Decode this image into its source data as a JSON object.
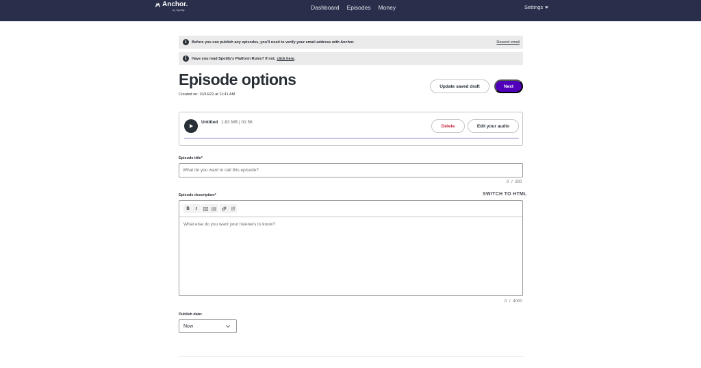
{
  "topbar": {
    "logo_text": "Anchor.",
    "logo_sub": "by Spotify",
    "nav": [
      "Dashboard",
      "Episodes",
      "Money"
    ],
    "settings_label": "Settings"
  },
  "banners": {
    "verify_text": "Before you can publish any episodes, you'll need to verify your email address with Anchor.",
    "resend_label": "Resend email",
    "rules_text": "Have you read Spotify's Platform Rules? If not,",
    "rules_link": "click here",
    "rules_suffix": "."
  },
  "page": {
    "title": "Episode options",
    "created": "Created on: 10/16/22 at 11:41 AM",
    "update_draft_label": "Update saved draft",
    "next_label": "Next"
  },
  "audio": {
    "name": "Untitled",
    "meta": "1.82 MB | 01:56",
    "delete_label": "Delete",
    "edit_label": "Edit your audio",
    "progress": 0
  },
  "form": {
    "title_label": "Episode title*",
    "title_placeholder": "What do you want to call this episode?",
    "title_counter": "0 / 200",
    "desc_label": "Episode description*",
    "switch_html_label": "SWITCH TO HTML",
    "desc_placeholder": "What else do you want your listeners to know?",
    "desc_counter": "0 / 4000",
    "toolbar": {
      "bold": "B",
      "italic": "I"
    },
    "publish_label": "Publish date:",
    "publish_value": "Now"
  }
}
